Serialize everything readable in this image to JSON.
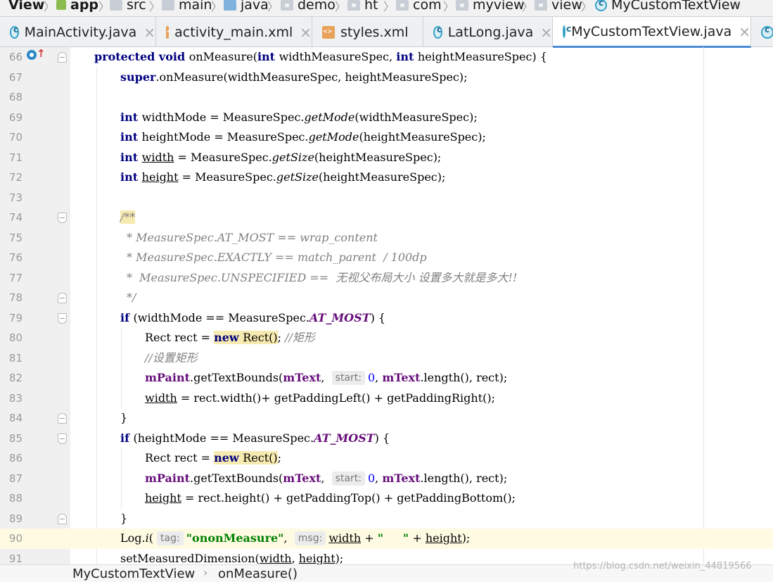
{
  "breadcrumb": [
    "View",
    "app",
    "src",
    "main",
    "java",
    "demo",
    "ht",
    "com",
    "myview",
    "view",
    "MyCustomTextView"
  ],
  "tabs": [
    {
      "label": "MainActivity.java",
      "type": "java",
      "active": false
    },
    {
      "label": "activity_main.xml",
      "type": "xml",
      "active": false
    },
    {
      "label": "styles.xml",
      "type": "xml",
      "active": false
    },
    {
      "label": "LatLong.java",
      "type": "java",
      "active": false
    },
    {
      "label": "MyCustomTextView.java",
      "type": "java",
      "active": true
    }
  ],
  "close_glyph": "×",
  "code": {
    "current_line": "90",
    "lines": [
      {
        "n": "66",
        "text": "protected void onMeasure(int widthMeasureSpec, int heightMeasureSpec) {"
      },
      {
        "n": "67",
        "text": "super.onMeasure(widthMeasureSpec, heightMeasureSpec);"
      },
      {
        "n": "68",
        "text": ""
      },
      {
        "n": "69",
        "text": "int widthMode = MeasureSpec.getMode(widthMeasureSpec);"
      },
      {
        "n": "70",
        "text": "int heightMode = MeasureSpec.getMode(heightMeasureSpec);"
      },
      {
        "n": "71",
        "text": "int width = MeasureSpec.getSize(heightMeasureSpec);"
      },
      {
        "n": "72",
        "text": "int height = MeasureSpec.getSize(heightMeasureSpec);"
      },
      {
        "n": "73",
        "text": ""
      },
      {
        "n": "74",
        "text": "/**"
      },
      {
        "n": "75",
        "text": "* MeasureSpec.AT_MOST == wrap_content"
      },
      {
        "n": "76",
        "text": "* MeasureSpec.EXACTLY == match_parent  / 100dp"
      },
      {
        "n": "77",
        "text": "*  MeasureSpec.UNSPECIFIED ==  无视父布局大小 设置多大就是多大!!"
      },
      {
        "n": "78",
        "text": "*/"
      },
      {
        "n": "79",
        "text": "if (widthMode == MeasureSpec.AT_MOST) {"
      },
      {
        "n": "80",
        "text": "Rect rect = new Rect(); //矩形"
      },
      {
        "n": "81",
        "text": "//设置矩形"
      },
      {
        "n": "82",
        "text": "mPaint.getTextBounds(mText,  start: 0, mText.length(), rect);"
      },
      {
        "n": "83",
        "text": "width = rect.width()+ getPaddingLeft() + getPaddingRight();"
      },
      {
        "n": "84",
        "text": "}"
      },
      {
        "n": "85",
        "text": "if (heightMode == MeasureSpec.AT_MOST) {"
      },
      {
        "n": "86",
        "text": "Rect rect = new Rect();"
      },
      {
        "n": "87",
        "text": "mPaint.getTextBounds(mText,  start: 0, mText.length(), rect);"
      },
      {
        "n": "88",
        "text": "height = rect.height() + getPaddingTop() + getPaddingBottom();"
      },
      {
        "n": "89",
        "text": "}"
      },
      {
        "n": "90",
        "text": "Log.i( tag: \"ononMeasure\",  msg: width + \"     \" + height);"
      },
      {
        "n": "91",
        "text": "setMeasuredDimension(width, height);"
      }
    ]
  },
  "hints": {
    "start": "start:",
    "tag": "tag:",
    "msg": "msg:"
  },
  "footer": {
    "class_name": "MyCustomTextView",
    "method_name": "onMeasure()",
    "separator": "›"
  },
  "watermark": "https://blog.csdn.net/weixin_44819566",
  "colors": {
    "keyword": "#000080",
    "field": "#660e7a",
    "string": "#008000",
    "number": "#0000ff",
    "comment": "#808080",
    "current_line": "#fffbe3"
  }
}
